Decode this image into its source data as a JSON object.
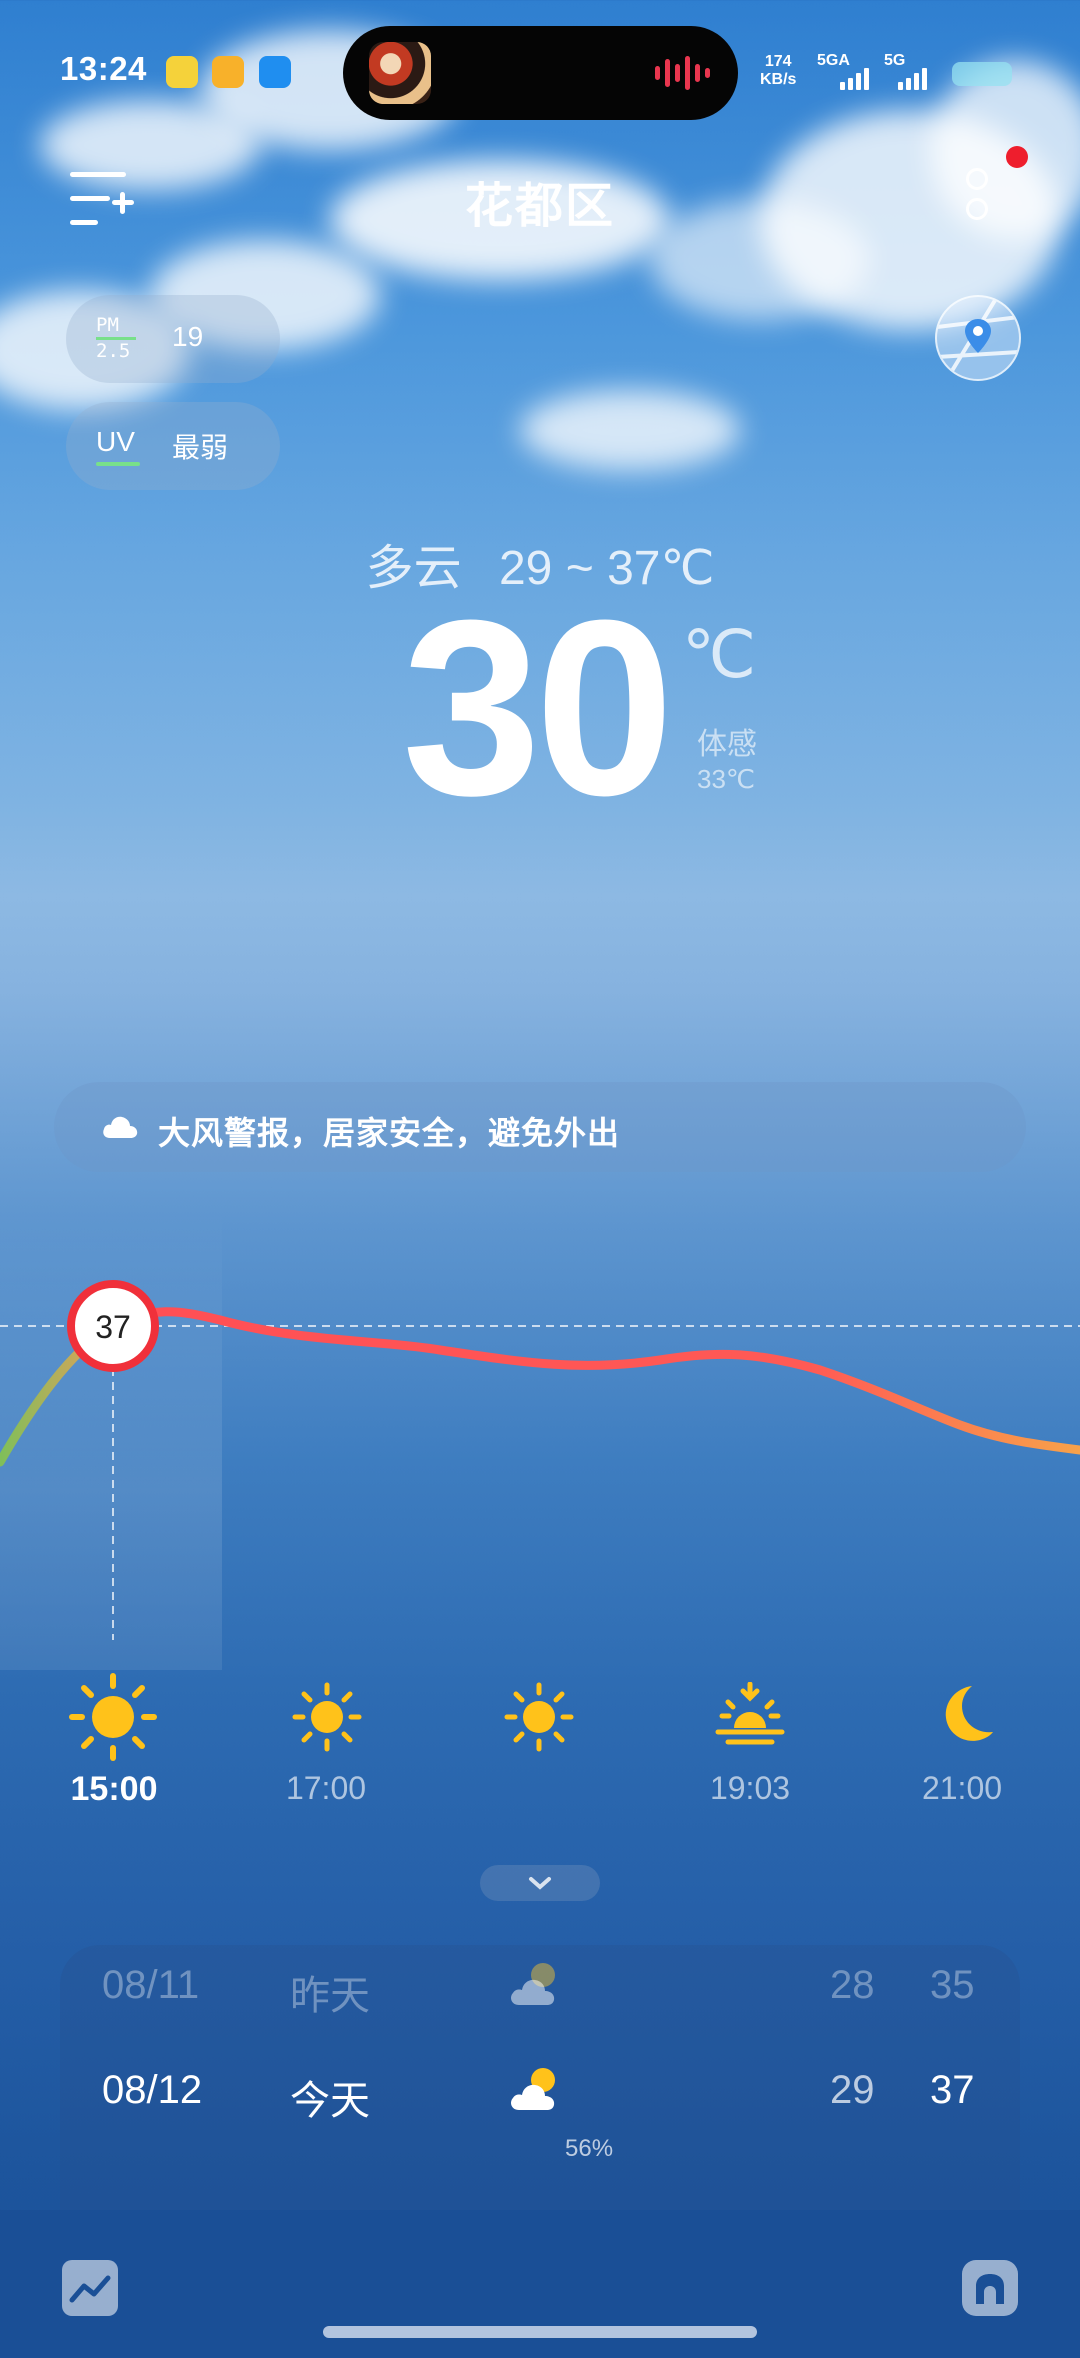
{
  "status_bar": {
    "time": "13:24",
    "app_icons": [
      "qq-music-icon",
      "weibo-icon",
      "app-icon"
    ],
    "net_speed_value": "174",
    "net_speed_unit": "KB/s",
    "sim1_label": "5GA",
    "sim2_label": "5G"
  },
  "header": {
    "city": "花都区",
    "menu_icon": "add-city-menu-icon",
    "more_icon": "more-vertical-icon"
  },
  "air": {
    "pm_label_top": "PM",
    "pm_label_bottom": "2.5",
    "pm_value": "19",
    "uv_label": "UV",
    "uv_value": "最弱"
  },
  "current": {
    "condition": "多云",
    "range": "29 ~ 37℃",
    "temp": "30",
    "unit": "℃",
    "feels_label": "体感",
    "feels_value": "33℃"
  },
  "alert": {
    "text": "大风警报，居家安全，避免外出"
  },
  "hourly": {
    "selected_temp": "37",
    "items": [
      {
        "time": "15:00",
        "icon": "sun-icon"
      },
      {
        "time": "17:00",
        "icon": "sun-icon"
      },
      {
        "time": "",
        "icon": "sun-icon"
      },
      {
        "time": "19:03",
        "icon": "sunset-icon"
      },
      {
        "time": "21:00",
        "icon": "moon-icon"
      }
    ]
  },
  "daily": [
    {
      "date": "08/11",
      "day": "昨天",
      "low": "28",
      "high": "35",
      "icon": "partly-cloudy-icon"
    },
    {
      "date": "08/12",
      "day": "今天",
      "low": "29",
      "high": "37",
      "icon": "partly-cloudy-icon"
    }
  ],
  "next_row_rain": "56%",
  "colors": {
    "curve_start": "#7fbf5a",
    "curve_hot": "#ff4f55",
    "curve_end": "#f7a24a",
    "sun": "#ffc21a",
    "alert_dot": "#ee1e2d"
  }
}
